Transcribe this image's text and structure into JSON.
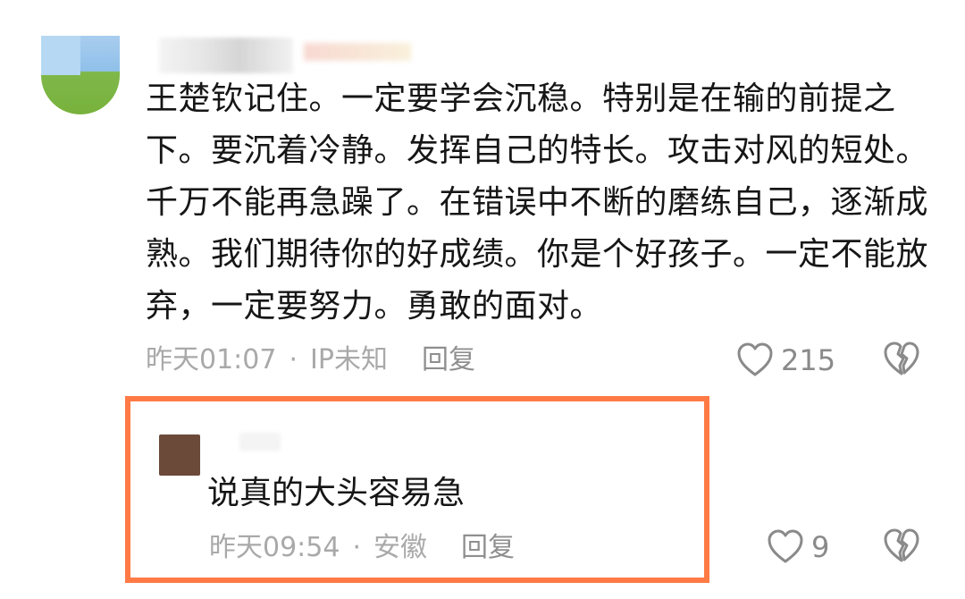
{
  "main_comment": {
    "text": "王楚钦记住。一定要学会沉稳。特别是在输的前提之下。要沉着冷静。发挥自己的特长。攻击对风的短处。千万不能再急躁了。在错误中不断的磨练自己，逐渐成熟。我们期待你的好成绩。你是个好孩子。一定不能放弃，一定要努力。勇敢的面对。",
    "time": "昨天01:07",
    "separator": "·",
    "location": "IP未知",
    "reply_label": "回复",
    "likes": "215"
  },
  "reply_comment": {
    "text": "说真的大头容易急",
    "time": "昨天09:54",
    "separator": "·",
    "location": "安徽",
    "reply_label": "回复",
    "likes": "9"
  },
  "icons": {
    "like": "heart-outline-icon",
    "dislike": "broken-heart-icon"
  },
  "colors": {
    "highlight_border": "#ff7a45",
    "meta_text": "#a9a9a9"
  }
}
